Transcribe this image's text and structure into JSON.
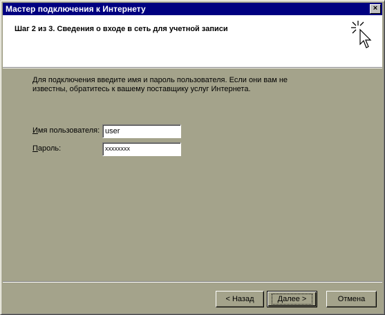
{
  "window": {
    "title": "Мастер подключения к Интернету",
    "close_glyph": "×"
  },
  "header": {
    "step_title": "Шаг 2 из 3. Сведения о входе в сеть для учетной записи",
    "icon": "wizard-cursor-icon"
  },
  "main": {
    "description": "Для подключения введите имя и пароль пользователя. Если они вам не известны, обратитесь к вашему поставщику услуг Интернета.",
    "username": {
      "label_mnemonic": "И",
      "label_rest": "мя пользователя:",
      "value": "user"
    },
    "password": {
      "label_mnemonic": "П",
      "label_rest": "ароль:",
      "value": "xxxxxxxx"
    }
  },
  "buttons": {
    "back": "< Назад",
    "next": "Далее >",
    "cancel": "Отмена"
  },
  "colors": {
    "title_bar": "#000080",
    "face": "#a4a38b",
    "header_bg": "#ffffff"
  }
}
